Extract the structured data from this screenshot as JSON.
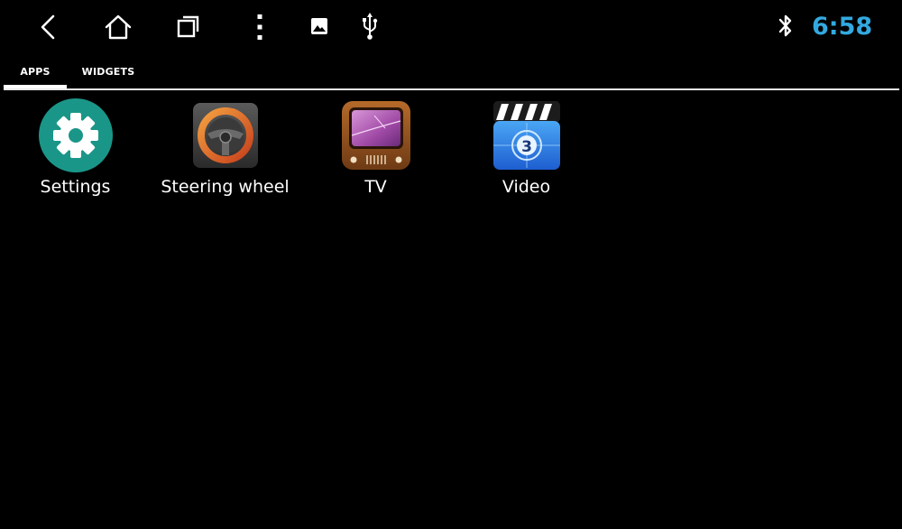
{
  "status_bar": {
    "time": "6:58",
    "time_color": "#33a9e0",
    "icons": [
      "image-notification-icon",
      "usb-icon",
      "bluetooth-icon"
    ]
  },
  "navigation": {
    "buttons": [
      "back-icon",
      "home-icon",
      "recents-icon",
      "more-options-icon"
    ]
  },
  "tabs": [
    {
      "label": "APPS",
      "selected": true
    },
    {
      "label": "WIDGETS",
      "selected": false
    }
  ],
  "apps": [
    {
      "label": "Settings",
      "icon": "settings-gear-icon",
      "color": "#1a9688"
    },
    {
      "label": "Steering wheel",
      "icon": "steering-wheel-icon",
      "color": "#e8762b"
    },
    {
      "label": "TV",
      "icon": "tv-icon",
      "color": "#8a4a1f"
    },
    {
      "label": "Video",
      "icon": "video-clapperboard-icon",
      "color": "#2f7fe0"
    }
  ]
}
